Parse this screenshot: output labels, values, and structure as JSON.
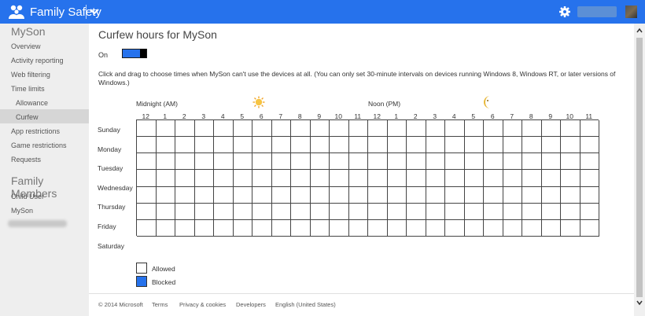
{
  "app": {
    "name": "Family Safety"
  },
  "sidebar": {
    "child_name": "MySon",
    "items": [
      "Overview",
      "Activity reporting",
      "Web filtering",
      "Time limits"
    ],
    "time_limits_sub": [
      "Allowance",
      "Curfew"
    ],
    "items2": [
      "App restrictions",
      "Game restrictions",
      "Requests"
    ],
    "family_heading": "Family Members",
    "members": [
      "Child User",
      "MySon"
    ]
  },
  "main": {
    "title": "Curfew hours for MySon",
    "toggle_label": "On",
    "instructions": "Click and drag to choose times when MySon can't use the devices at all. (You can only set 30-minute intervals on devices running Windows 8, Windows RT, or later versions of Windows.)",
    "midnight_label": "Midnight (AM)",
    "noon_label": "Noon (PM)",
    "hours": [
      "12",
      "1",
      "2",
      "3",
      "4",
      "5",
      "6",
      "7",
      "8",
      "9",
      "10",
      "11",
      "12",
      "1",
      "2",
      "3",
      "4",
      "5",
      "6",
      "7",
      "8",
      "9",
      "10",
      "11"
    ],
    "days": [
      "Sunday",
      "Monday",
      "Tuesday",
      "Wednesday",
      "Thursday",
      "Friday",
      "Saturday"
    ],
    "legend": {
      "allowed": "Allowed",
      "blocked": "Blocked"
    }
  },
  "footer": {
    "copyright": "© 2014 Microsoft",
    "terms": "Terms",
    "privacy": "Privacy & cookies",
    "developers": "Developers",
    "language": "English (United States)"
  },
  "colors": {
    "accent": "#2672ec",
    "sidebar_bg": "#eeeeee"
  }
}
